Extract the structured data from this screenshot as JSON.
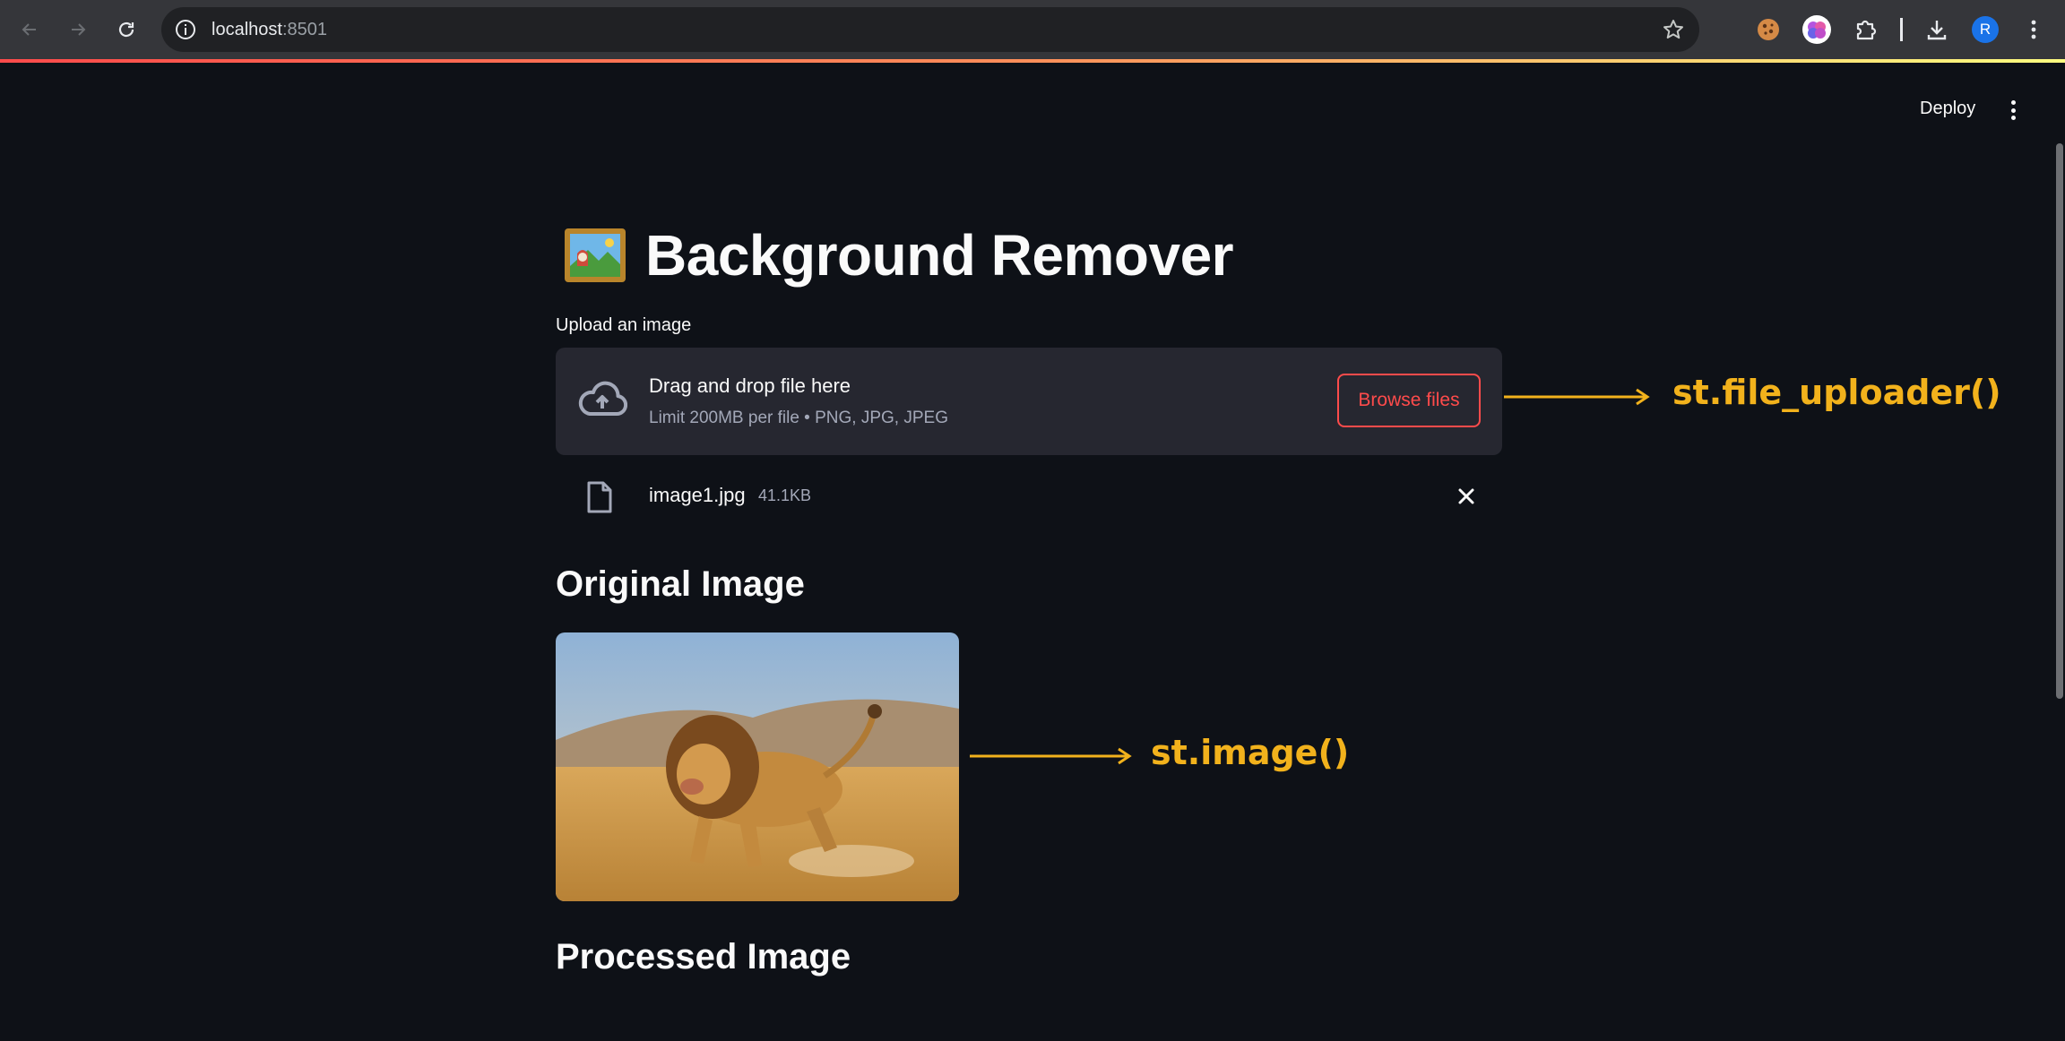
{
  "browser": {
    "url_host": "localhost",
    "url_port": ":8501",
    "profile_initial": "R"
  },
  "app": {
    "deploy_label": "Deploy",
    "title": "Background Remover",
    "title_emoji": "framed-picture-emoji"
  },
  "uploader": {
    "label": "Upload an image",
    "drop_text": "Drag and drop file here",
    "limit_text": "Limit 200MB per file • PNG, JPG, JPEG",
    "browse_label": "Browse files",
    "file_name": "image1.jpg",
    "file_size": "41.1KB"
  },
  "sections": {
    "original_heading": "Original Image",
    "processed_heading": "Processed Image"
  },
  "annotations": {
    "uploader_note": "st.file_uploader()",
    "image_note": "st.image()"
  },
  "colors": {
    "background": "#0e1117",
    "accent": "#ff4b4b",
    "annotation": "#f2b21c",
    "dropzone": "#262730"
  },
  "icons": [
    "back-icon",
    "forward-icon",
    "reload-icon",
    "info-icon",
    "star-icon",
    "cookie-extension-icon",
    "brain-extension-icon",
    "puzzle-extensions-icon",
    "download-icon",
    "profile-avatar",
    "chrome-menu-icon",
    "cloud-upload-icon",
    "file-icon",
    "close-icon",
    "kebab-menu-icon"
  ]
}
